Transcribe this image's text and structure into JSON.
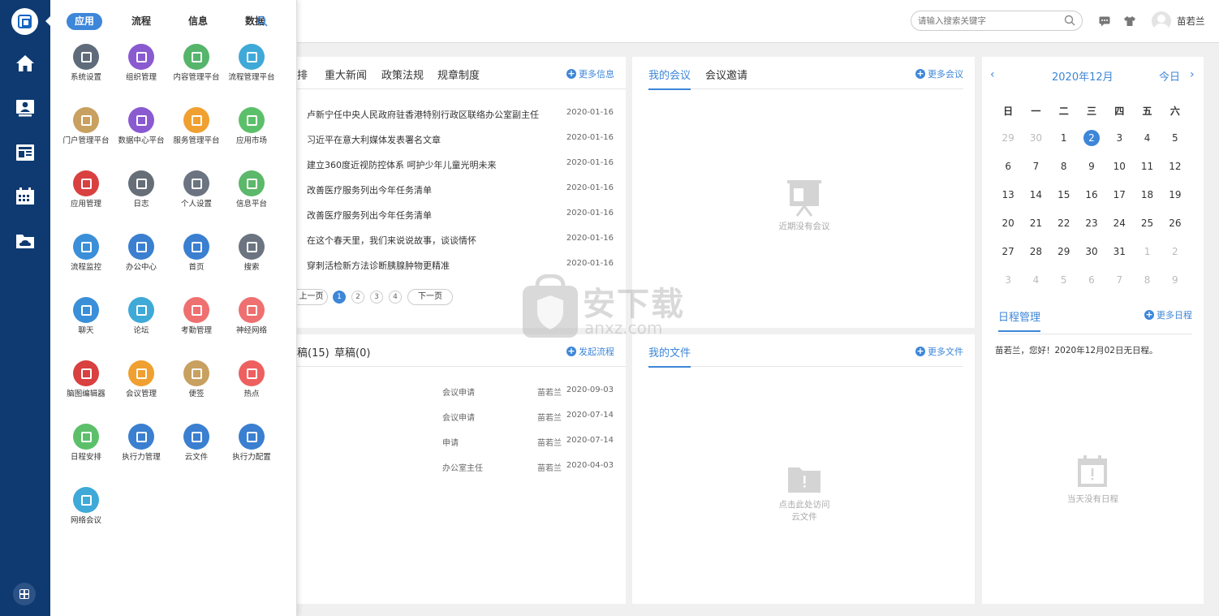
{
  "drawer": {
    "tabs": [
      "应用",
      "流程",
      "信息",
      "数据"
    ],
    "apps": [
      {
        "label": "系统设置",
        "color": "#5f6b7a"
      },
      {
        "label": "组织管理",
        "color": "#8a5ad0"
      },
      {
        "label": "内容管理平台",
        "color": "#54b56b"
      },
      {
        "label": "流程管理平台",
        "color": "#3fa9d8"
      },
      {
        "label": "门户管理平台",
        "color": "#c8a060"
      },
      {
        "label": "数据中心平台",
        "color": "#8a5ad0"
      },
      {
        "label": "服务管理平台",
        "color": "#f0a030"
      },
      {
        "label": "应用市场",
        "color": "#5cc06a"
      },
      {
        "label": "应用管理",
        "color": "#d94040"
      },
      {
        "label": "日志",
        "color": "#666e78"
      },
      {
        "label": "个人设置",
        "color": "#6b7480"
      },
      {
        "label": "信息平台",
        "color": "#5cb86a"
      },
      {
        "label": "流程监控",
        "color": "#3a8fd8"
      },
      {
        "label": "办公中心",
        "color": "#3a7fd0"
      },
      {
        "label": "首页",
        "color": "#3a7fd0"
      },
      {
        "label": "搜索",
        "color": "#6b7480"
      },
      {
        "label": "聊天",
        "color": "#3a8fd8"
      },
      {
        "label": "论坛",
        "color": "#3fa9d8"
      },
      {
        "label": "考勤管理",
        "color": "#ee7070"
      },
      {
        "label": "神经网络",
        "color": "#ee7070"
      },
      {
        "label": "脑图编辑器",
        "color": "#d94040"
      },
      {
        "label": "会议管理",
        "color": "#f0a030"
      },
      {
        "label": "便签",
        "color": "#c8a060"
      },
      {
        "label": "热点",
        "color": "#ee6060"
      },
      {
        "label": "日程安排",
        "color": "#5cc06a"
      },
      {
        "label": "执行力管理",
        "color": "#3a7fd0"
      },
      {
        "label": "云文件",
        "color": "#3a7fd0"
      },
      {
        "label": "执行力配置",
        "color": "#3a7fd0"
      },
      {
        "label": "网络会议",
        "color": "#3fa9d8"
      }
    ]
  },
  "header": {
    "search_placeholder": "请输入搜索关键字",
    "user_name": "苗若兰"
  },
  "news": {
    "tabs": [
      "排",
      "重大新闻",
      "政策法规",
      "规章制度"
    ],
    "more": "更多信息",
    "items": [
      {
        "title": "卢新宁任中央人民政府驻香港特别行政区联络办公室副主任",
        "date": "2020-01-16"
      },
      {
        "title": "习近平在意大利媒体发表署名文章",
        "date": "2020-01-16"
      },
      {
        "title": "建立360度近视防控体系 呵护少年儿童光明未来",
        "date": "2020-01-16"
      },
      {
        "title": "改善医疗服务列出今年任务清单",
        "date": "2020-01-16"
      },
      {
        "title": "改善医疗服务列出今年任务清单",
        "date": "2020-01-16"
      },
      {
        "title": "在这个春天里，我们来说说故事，谈谈情怀",
        "date": "2020-01-16"
      },
      {
        "title": "穿刺活检新方法诊断胰腺肿物更精准",
        "date": "2020-01-16"
      }
    ],
    "pager": {
      "prev": "上一页",
      "next": "下一页",
      "pages": [
        "1",
        "2",
        "3",
        "4"
      ]
    }
  },
  "flow": {
    "tabs": [
      "稿(15)",
      "草稿(0)"
    ],
    "more": "发起流程",
    "items": [
      {
        "title": "会议申请",
        "user": "苗若兰",
        "date": "2020-09-03"
      },
      {
        "title": "会议申请",
        "user": "苗若兰",
        "date": "2020-07-14"
      },
      {
        "title": "申请",
        "user": "苗若兰",
        "date": "2020-07-14"
      },
      {
        "title": "办公室主任",
        "user": "苗若兰",
        "date": "2020-04-03"
      }
    ]
  },
  "meetings": {
    "tabs": [
      "我的会议",
      "会议邀请"
    ],
    "more": "更多会议",
    "empty": "近期没有会议"
  },
  "files": {
    "tabs": [
      "我的文件"
    ],
    "more": "更多文件",
    "empty_line1": "点击此处访问",
    "empty_line2": "云文件"
  },
  "calendar": {
    "title": "2020年12月",
    "today": "今日",
    "weekdays": [
      "日",
      "一",
      "二",
      "三",
      "四",
      "五",
      "六"
    ],
    "weeks": [
      [
        "29",
        "30",
        "1",
        "2",
        "3",
        "4",
        "5"
      ],
      [
        "6",
        "7",
        "8",
        "9",
        "10",
        "11",
        "12"
      ],
      [
        "13",
        "14",
        "15",
        "16",
        "17",
        "18",
        "19"
      ],
      [
        "20",
        "21",
        "22",
        "23",
        "24",
        "25",
        "26"
      ],
      [
        "27",
        "28",
        "29",
        "30",
        "31",
        "1",
        "2"
      ],
      [
        "3",
        "4",
        "5",
        "6",
        "7",
        "8",
        "9"
      ]
    ],
    "selected": "2"
  },
  "schedule": {
    "tab": "日程管理",
    "more": "更多日程",
    "message": "苗若兰，您好！2020年12月02日无日程。",
    "empty": "当天没有日程"
  },
  "watermark": {
    "text": "安下载",
    "sub": "anxz.com"
  }
}
